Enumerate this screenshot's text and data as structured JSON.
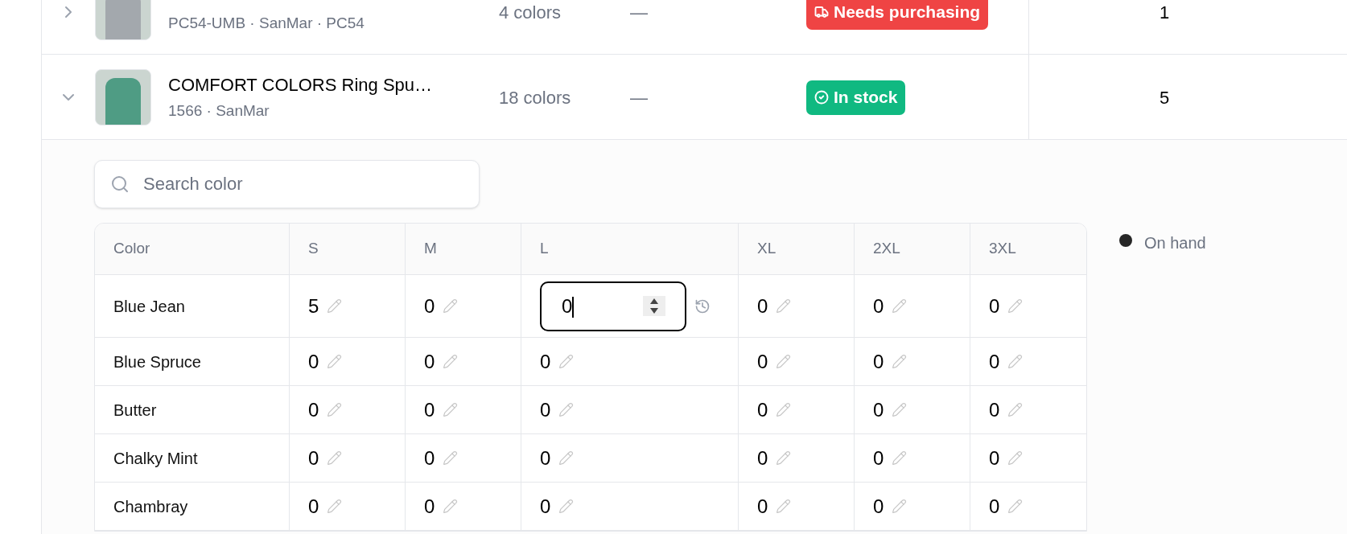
{
  "products": [
    {
      "expanded": false,
      "subtitle": "PC54-UMB · SanMar · PC54",
      "colors": "4 colors",
      "column_4": "—",
      "status": {
        "kind": "purchase",
        "label": "Needs purchasing"
      },
      "quantity": "1"
    },
    {
      "expanded": true,
      "title": "COMFORT COLORS Ring Spu…",
      "subtitle": "1566 · SanMar",
      "colors": "18 colors",
      "column_4": "—",
      "status": {
        "kind": "stock",
        "label": "In stock"
      },
      "quantity": "5"
    }
  ],
  "color_search": {
    "placeholder": "Search color"
  },
  "inventory": {
    "columns": [
      "Color",
      "S",
      "M",
      "L",
      "XL",
      "2XL",
      "3XL"
    ],
    "rows": [
      {
        "cells": [
          {
            "kind": "name",
            "value": "Blue Jean"
          },
          {
            "kind": "quantity",
            "value": "5",
            "editing": false
          },
          {
            "kind": "quantity",
            "value": "0",
            "editing": false
          },
          {
            "kind": "quantity",
            "value": "0",
            "editing": true
          },
          {
            "kind": "quantity",
            "value": "0",
            "editing": false
          },
          {
            "kind": "quantity",
            "value": "0",
            "editing": false
          },
          {
            "kind": "quantity",
            "value": "0",
            "editing": false
          }
        ]
      },
      {
        "cells": [
          {
            "kind": "name",
            "value": "Blue Spruce"
          },
          {
            "kind": "quantity",
            "value": "0",
            "editing": false
          },
          {
            "kind": "quantity",
            "value": "0",
            "editing": false
          },
          {
            "kind": "quantity",
            "value": "0",
            "editing": false
          },
          {
            "kind": "quantity",
            "value": "0",
            "editing": false
          },
          {
            "kind": "quantity",
            "value": "0",
            "editing": false
          },
          {
            "kind": "quantity",
            "value": "0",
            "editing": false
          }
        ]
      },
      {
        "cells": [
          {
            "kind": "name",
            "value": "Butter"
          },
          {
            "kind": "quantity",
            "value": "0",
            "editing": false
          },
          {
            "kind": "quantity",
            "value": "0",
            "editing": false
          },
          {
            "kind": "quantity",
            "value": "0",
            "editing": false
          },
          {
            "kind": "quantity",
            "value": "0",
            "editing": false
          },
          {
            "kind": "quantity",
            "value": "0",
            "editing": false
          },
          {
            "kind": "quantity",
            "value": "0",
            "editing": false
          }
        ]
      },
      {
        "cells": [
          {
            "kind": "name",
            "value": "Chalky Mint"
          },
          {
            "kind": "quantity",
            "value": "0",
            "editing": false
          },
          {
            "kind": "quantity",
            "value": "0",
            "editing": false
          },
          {
            "kind": "quantity",
            "value": "0",
            "editing": false
          },
          {
            "kind": "quantity",
            "value": "0",
            "editing": false
          },
          {
            "kind": "quantity",
            "value": "0",
            "editing": false
          },
          {
            "kind": "quantity",
            "value": "0",
            "editing": false
          }
        ]
      },
      {
        "cells": [
          {
            "kind": "name",
            "value": "Chambray"
          },
          {
            "kind": "quantity",
            "value": "0",
            "editing": false
          },
          {
            "kind": "quantity",
            "value": "0",
            "editing": false
          },
          {
            "kind": "quantity",
            "value": "0",
            "editing": false
          },
          {
            "kind": "quantity",
            "value": "0",
            "editing": false
          },
          {
            "kind": "quantity",
            "value": "0",
            "editing": false
          },
          {
            "kind": "quantity",
            "value": "0",
            "editing": false
          }
        ]
      }
    ]
  },
  "legend": {
    "label": "On hand"
  }
}
